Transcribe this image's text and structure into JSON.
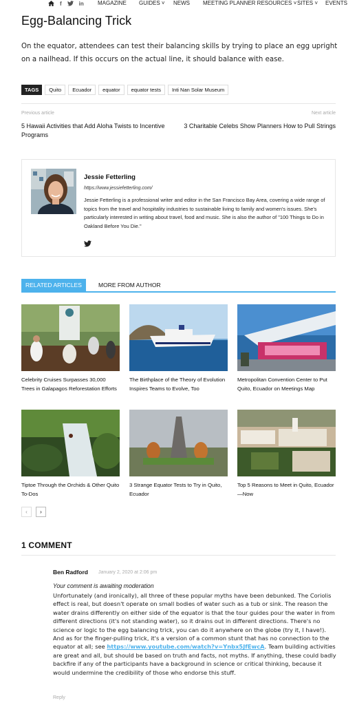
{
  "nav": {
    "icons": [
      "home-icon",
      "facebook-icon",
      "twitter-icon",
      "linkedin-icon"
    ],
    "items": [
      "MAGAZINE",
      "GUIDES",
      "NEWS",
      "MEETING PLANNER RESOURCES",
      "SITES",
      "EVENTS"
    ]
  },
  "article": {
    "title": "Egg-Balancing Trick",
    "intro": "On the equator, attendees can test their balancing skills by trying to place an egg upright on a nailhead. If this occurs on the actual line, it should balance with ease."
  },
  "tags": {
    "label": "TAGS",
    "items": [
      "Quito",
      "Ecuador",
      "equator",
      "equator tests",
      "Inti Nan Solar Museum"
    ]
  },
  "post_nav": {
    "prev_label": "Previous article",
    "prev_title": "5 Hawaii Activities that Add Aloha Twists to Incentive Programs",
    "next_label": "Next article",
    "next_title": "3 Charitable Celebs Show Planners How to Pull Strings"
  },
  "author": {
    "name": "Jessie Fetterling",
    "url": "https://www.jessiefetterling.com/",
    "bio": "Jessie Fetterling is a professional writer and editor in the San Francisco Bay Area, covering a wide range of topics from the travel and hospitality industries to sustainable living to family and women's issues. She's particularly interested in writing about travel, food and music. She is also the author of \"100 Things to Do in Oakland Before You Die.\""
  },
  "related": {
    "tab_active": "RELATED ARTICLES",
    "tab_other": "MORE FROM AUTHOR",
    "cards": [
      {
        "title": "Celebrity Cruises Surpasses 30,000 Trees in Galapagos Reforestation Efforts"
      },
      {
        "title": "The Birthplace of the Theory of Evolution Inspires Teams to Evolve, Too"
      },
      {
        "title": "Metropolitan Convention Center to Put Quito, Ecuador on Meetings Map"
      },
      {
        "title": "Tiptoe Through the Orchids & Other Quito To-Dos"
      },
      {
        "title": "3 Strange Equator Tests to Try in Quito, Ecuador"
      },
      {
        "title": "Top 5 Reasons to Meet in Quito, Ecuador—Now"
      }
    ],
    "pager_prev": "‹",
    "pager_next": "›"
  },
  "comments": {
    "heading": "1 COMMENT",
    "author": "Ben Radford",
    "date": "January 2, 2020 at 2:06 pm",
    "awaiting": "Your comment is awaiting moderation",
    "body_before": "Unfortunately (and ironically), all three of these popular myths have been debunked. The Coriolis effect is real, but doesn't operate on small bodies of water such as a tub or sink. The reason the water drains differently on either side of the equator is that the tour guides pour the water in from different directions (it's not standing water), so it drains out in different directions. There's no science or logic to the egg balancing trick, you can do it anywhere on the globe (try it, I have!). And as for the finger-pulling trick, it's a version of a common stunt that has no connection to the equator at all; see ",
    "link": "https://www.youtube.com/watch?v=Ynbx5JfEwcA",
    "body_after": ". Team building activities are great and all, but should be based on truth and facts, not myths. If anything, these could badly backfire if any of the participants have a background in science or critical thinking, because it would undermine the credibility of those who endorse this stuff.",
    "reply": "Reply"
  }
}
